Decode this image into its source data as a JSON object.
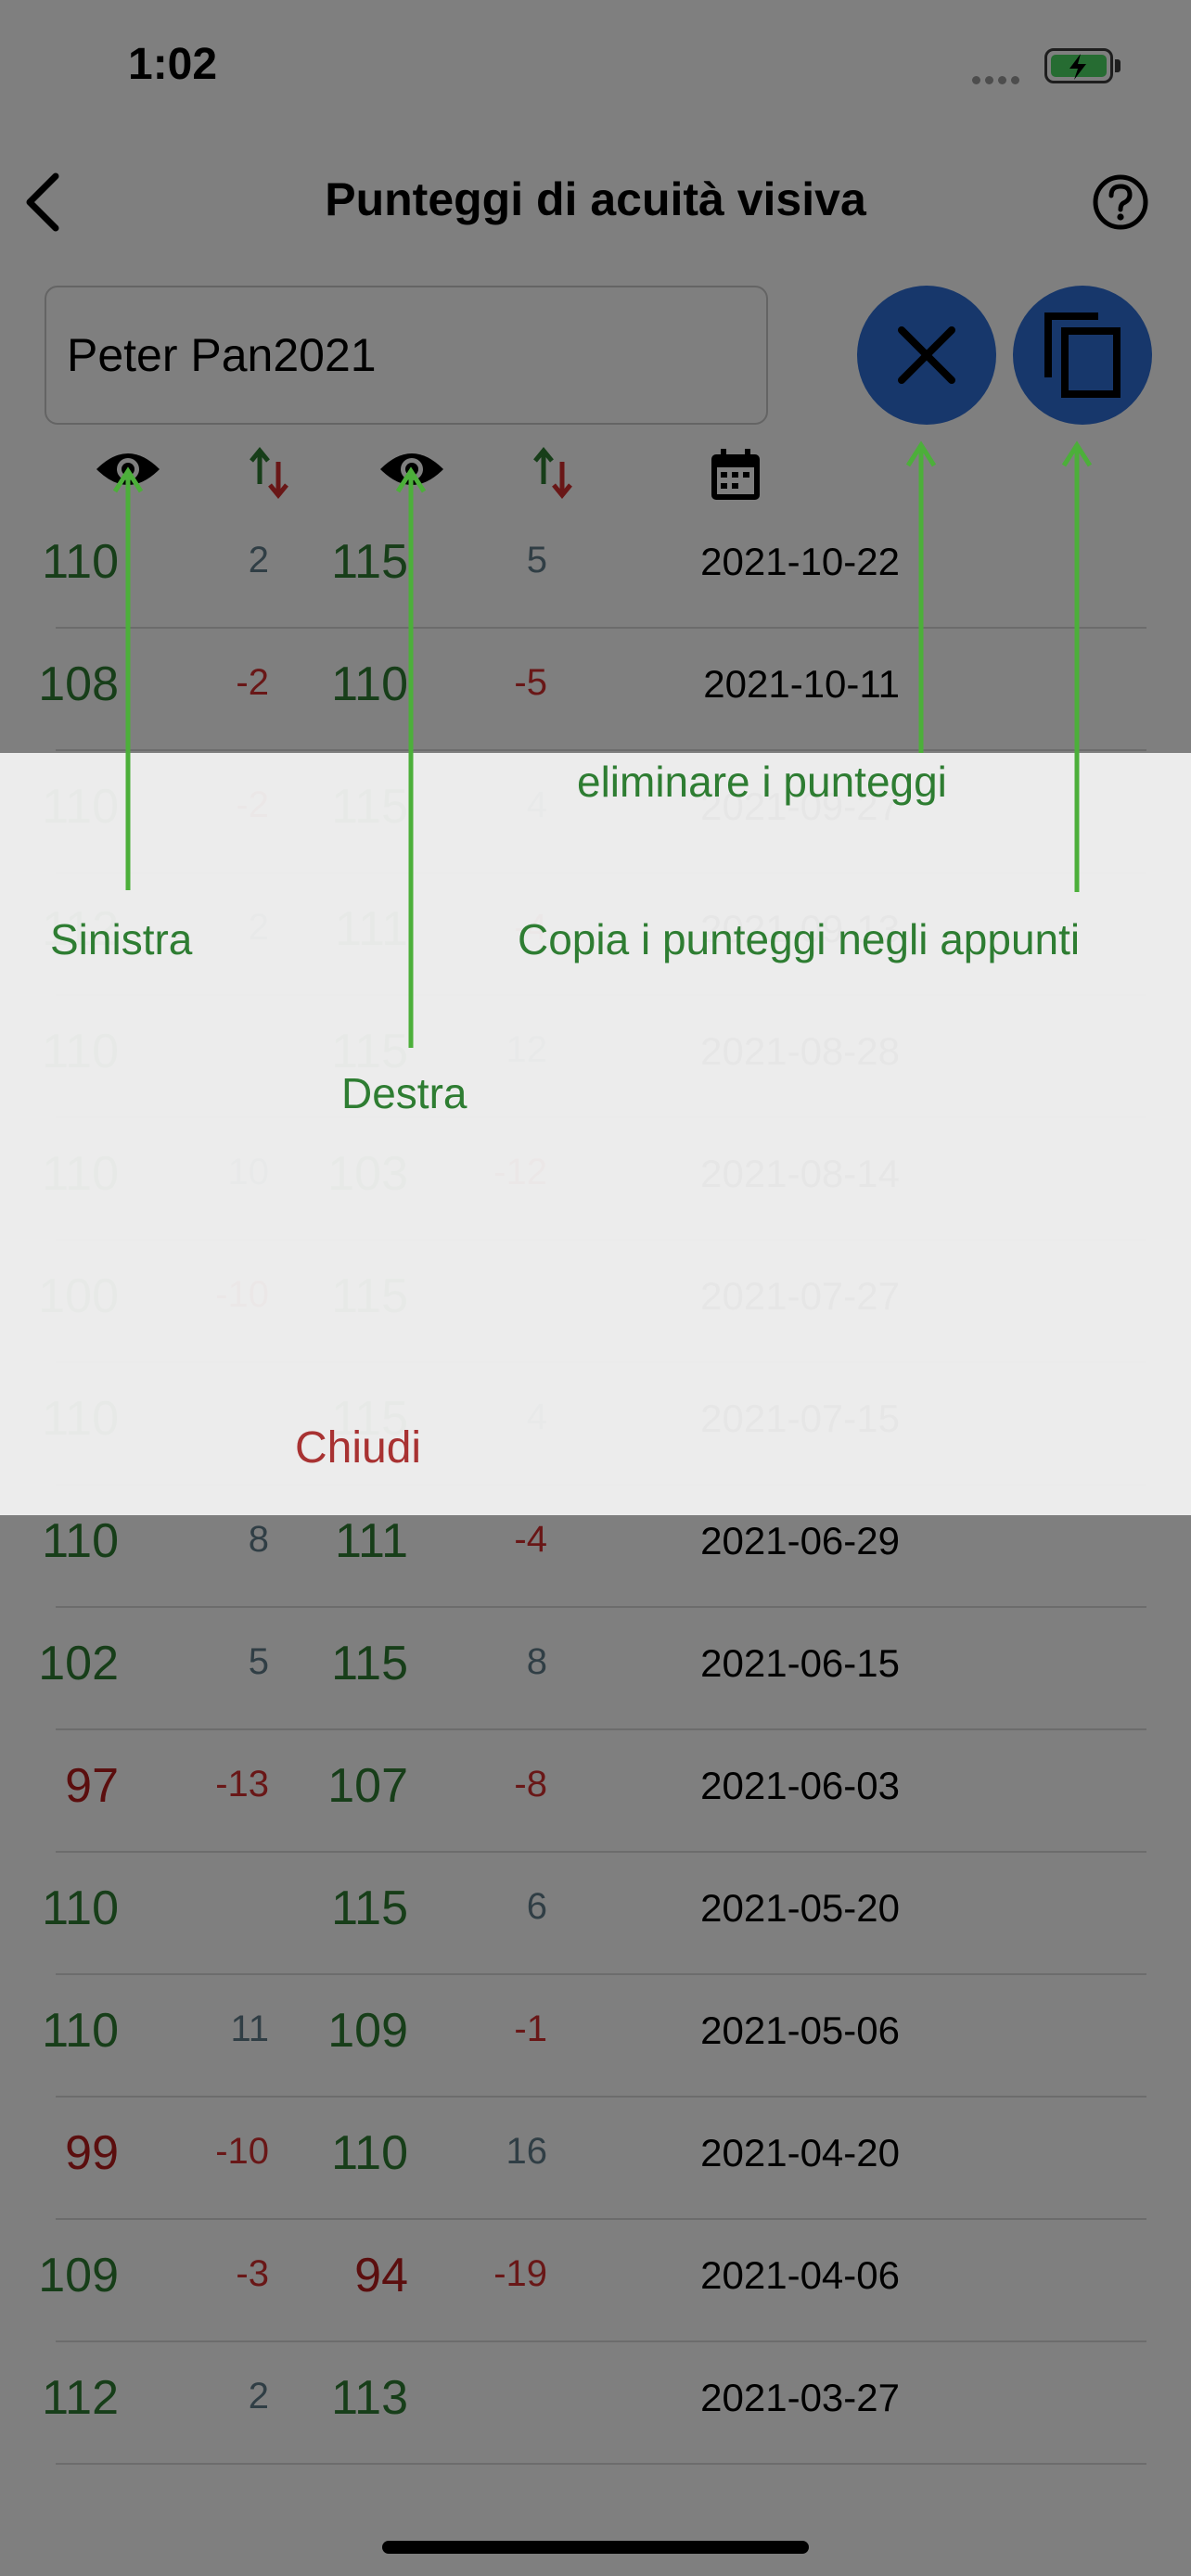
{
  "status_bar": {
    "time": "1:02"
  },
  "header": {
    "title": "Punteggi di acuità visiva"
  },
  "patient": {
    "name": "Peter Pan2021"
  },
  "rows": [
    {
      "left": "110",
      "left_delta": "2",
      "right": "115",
      "right_delta": "5",
      "date": "2021-10-22"
    },
    {
      "left": "108",
      "left_delta": "-2",
      "right": "110",
      "right_delta": "-5",
      "date": "2021-10-11"
    },
    {
      "left": "110",
      "left_delta": "-2",
      "right": "115",
      "right_delta": "4",
      "date": "2021-09-27"
    },
    {
      "left": "112",
      "left_delta": "2",
      "right": "111",
      "right_delta": "-4",
      "date": "2021-09-13"
    },
    {
      "left": "110",
      "left_delta": "",
      "right": "115",
      "right_delta": "12",
      "date": "2021-08-28"
    },
    {
      "left": "110",
      "left_delta": "10",
      "right": "103",
      "right_delta": "-12",
      "date": "2021-08-14"
    },
    {
      "left": "100",
      "left_delta": "-10",
      "right": "115",
      "right_delta": "",
      "date": "2021-07-27"
    },
    {
      "left": "110",
      "left_delta": "",
      "right": "115",
      "right_delta": "4",
      "date": "2021-07-15"
    },
    {
      "left": "110",
      "left_delta": "8",
      "right": "111",
      "right_delta": "-4",
      "date": "2021-06-29"
    },
    {
      "left": "102",
      "left_delta": "5",
      "right": "115",
      "right_delta": "8",
      "date": "2021-06-15"
    },
    {
      "left": "97",
      "left_delta": "-13",
      "right": "107",
      "right_delta": "-8",
      "date": "2021-06-03"
    },
    {
      "left": "110",
      "left_delta": "",
      "right": "115",
      "right_delta": "6",
      "date": "2021-05-20"
    },
    {
      "left": "110",
      "left_delta": "11",
      "right": "109",
      "right_delta": "-1",
      "date": "2021-05-06"
    },
    {
      "left": "99",
      "left_delta": "-10",
      "right": "110",
      "right_delta": "16",
      "date": "2021-04-20"
    },
    {
      "left": "109",
      "left_delta": "-3",
      "right": "94",
      "right_delta": "-19",
      "date": "2021-04-06"
    },
    {
      "left": "112",
      "left_delta": "2",
      "right": "113",
      "right_delta": "",
      "date": "2021-03-27"
    }
  ],
  "help_overlay": {
    "delete_label": "eliminare i punteggi",
    "left_label": "Sinistra",
    "copy_label": "Copia i punteggi negli appunti",
    "right_label": "Destra",
    "close_label": "Chiudi"
  },
  "colors": {
    "score_good": "#2e7d32",
    "score_bad": "#b71c1c",
    "delta_pos": "#607d8b",
    "delta_neg": "#d32f2f",
    "button_blue": "#2f6fd6",
    "arrow_green": "#4caf3a"
  },
  "icons": [
    "back-chevron-icon",
    "help-circle-icon",
    "close-x-icon",
    "copy-icon",
    "eye-icon",
    "up-down-arrows-icon",
    "calendar-icon"
  ]
}
